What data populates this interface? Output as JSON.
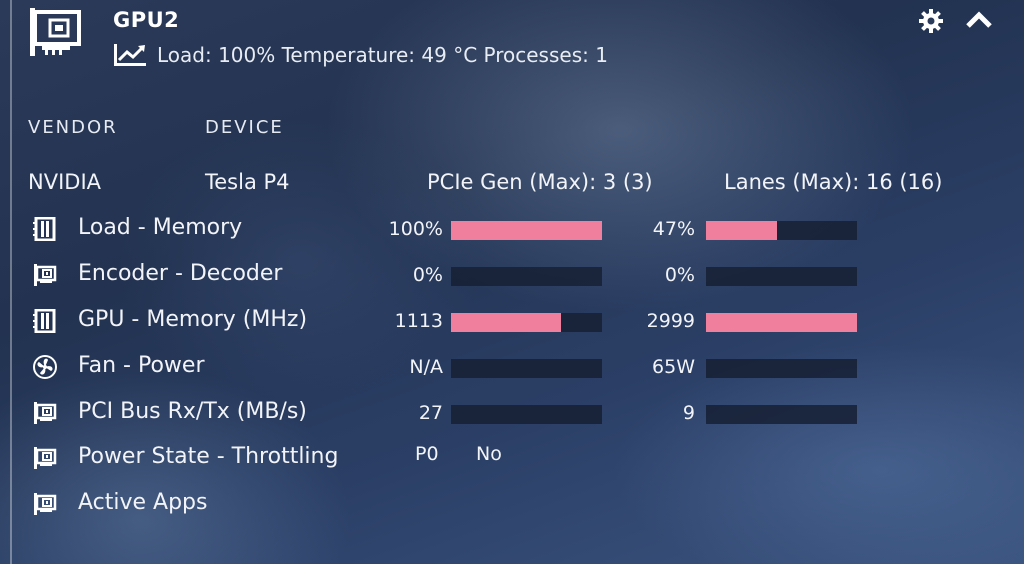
{
  "header": {
    "title": "GPU2",
    "subline": "Load: 100% Temperature: 49 °C Processes: 1"
  },
  "columns": {
    "vendor": "VENDOR",
    "device": "DEVICE"
  },
  "info": {
    "vendor": "NVIDIA",
    "device": "Tesla P4",
    "pcie": "PCIe Gen (Max): 3 (3)",
    "lanes": "Lanes (Max): 16 (16)"
  },
  "rows": [
    {
      "label": "Load - Memory",
      "icon": "memory-chip-icon",
      "v1": "100%",
      "f1": 1.0,
      "v2": "47%",
      "f2": 0.47
    },
    {
      "label": "Encoder - Decoder",
      "icon": "gpu-card-icon",
      "v1": "0%",
      "f1": 0.0,
      "v2": "0%",
      "f2": 0.0
    },
    {
      "label": "GPU - Memory (MHz)",
      "icon": "memory-chip-icon",
      "v1": "1113",
      "f1": 0.73,
      "v2": "2999",
      "f2": 1.0
    },
    {
      "label": "Fan - Power",
      "icon": "fan-icon",
      "v1": "N/A",
      "f1": 0.0,
      "v2": "65W",
      "f2": 0.0
    },
    {
      "label": "PCI Bus Rx/Tx (MB/s)",
      "icon": "gpu-card-icon",
      "v1": "27",
      "f1": 0.0,
      "v2": "9",
      "f2": 0.0
    },
    {
      "label": "Power State - Throttling",
      "icon": "gpu-card-icon",
      "v1": "P0",
      "v2": "No"
    },
    {
      "label": "Active Apps",
      "icon": "gpu-card-icon"
    }
  ],
  "colors": {
    "bar_fill": "#f07f9e",
    "bar_track": "#162034"
  }
}
